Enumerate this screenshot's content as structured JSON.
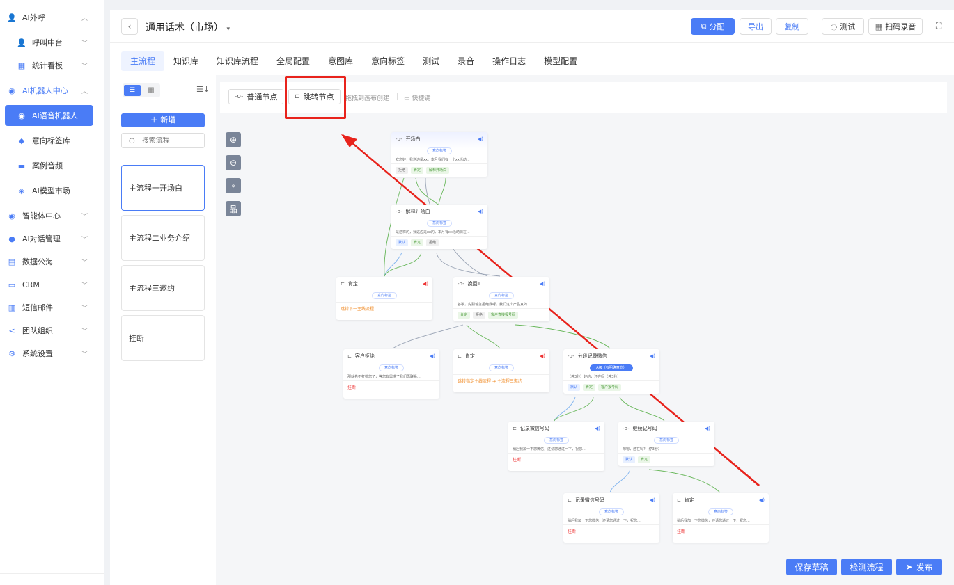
{
  "sidebar": {
    "items": [
      {
        "label": "AI外呼",
        "icon": "person-icon",
        "level": 1,
        "chev": "up"
      },
      {
        "label": "呼叫中台",
        "icon": "person-icon",
        "level": 2,
        "chev": "down"
      },
      {
        "label": "统计看板",
        "icon": "chart-icon",
        "level": 2,
        "chev": "down"
      },
      {
        "label": "AI机器人中心",
        "icon": "robot-icon",
        "level": 1,
        "chev": "up",
        "blue": true
      },
      {
        "label": "AI语音机器人",
        "icon": "robot-icon",
        "level": 2,
        "active": true
      },
      {
        "label": "意向标签库",
        "icon": "tag-icon",
        "level": 2
      },
      {
        "label": "案例音频",
        "icon": "folder-icon",
        "level": 2
      },
      {
        "label": "AI模型市场",
        "icon": "cube-icon",
        "level": 2
      },
      {
        "label": "智能体中心",
        "icon": "agent-icon",
        "level": 1,
        "chev": "down"
      },
      {
        "label": "AI对话管理",
        "icon": "chat-icon",
        "level": 1,
        "chev": "down"
      },
      {
        "label": "数据公海",
        "icon": "data-icon",
        "level": 1,
        "chev": "down"
      },
      {
        "label": "CRM",
        "icon": "crm-icon",
        "level": 1,
        "chev": "down"
      },
      {
        "label": "短信邮件",
        "icon": "mail-icon",
        "level": 1,
        "chev": "down"
      },
      {
        "label": "团队组织",
        "icon": "team-icon",
        "level": 1,
        "chev": "down"
      },
      {
        "label": "系统设置",
        "icon": "gear-icon",
        "level": 1,
        "chev": "down"
      }
    ]
  },
  "header": {
    "title": "通用话术（市场）",
    "buttons": {
      "assign": "分配",
      "export": "导出",
      "copy": "复制",
      "test": "测试",
      "scan": "扫码录音"
    }
  },
  "tabs": [
    "主流程",
    "知识库",
    "知识库流程",
    "全局配置",
    "意图库",
    "意向标签",
    "测试",
    "录音",
    "操作日志",
    "模型配置"
  ],
  "left": {
    "add": "新增",
    "search_placeholder": "搜索流程",
    "flows": [
      "主流程一开场白",
      "主流程二业务介绍",
      "主流程三邀约",
      "挂断"
    ]
  },
  "nodebar": {
    "normal": "普通节点",
    "jump": "跳转节点",
    "hint": "拖拽到画布创建",
    "shortcut": "快捷键"
  },
  "nodes": {
    "n1": {
      "title": "开场白",
      "tag": "意向标签",
      "text": "欢您好，我这边是xx。本月我们有一个xx活动...",
      "pills": [
        "拒绝",
        "肯定",
        "解释开场白"
      ]
    },
    "n2": {
      "title": "解释开场白",
      "tag": "意向标签",
      "text": "是这样的，我这边是xx的，本月有xx活动现在...",
      "pills": [
        "默认",
        "肯定",
        "拒绝"
      ]
    },
    "n3": {
      "title": "肯定",
      "tag": "意向标签",
      "action": "跳转下一主线流程"
    },
    "n4": {
      "title": "挽回1",
      "tag": "意向标签",
      "text": "谷歌，先别着急拒绝我呀，我们这个产品真的...",
      "pills": [
        "肯定",
        "拒绝",
        "客户直接报号码"
      ]
    },
    "n5": {
      "title": "客户拒绝",
      "tag": "意向标签",
      "text": "那就先不打扰您了，等您有需求了我们再联系...",
      "action": "挂断"
    },
    "n6": {
      "title": "肯定",
      "tag": "意向标签",
      "action": "跳转指定主线流程 → 主流程三邀约"
    },
    "n7": {
      "title": "分段记录微信",
      "tag": "A级（有明确意向）",
      "text": "（停3秒）好的，还在吗（停3秒）",
      "pills": [
        "默认",
        "肯定",
        "客户报号码"
      ]
    },
    "n8": {
      "title": "记录微信号码",
      "tag": "意向标签",
      "text": "稍后我加一下您微信，还请您通过一下，祝您...",
      "action": "挂断"
    },
    "n9": {
      "title": "继续记号码",
      "tag": "意向标签",
      "text": "嗯嗯，还在吗?（停3秒）",
      "pills": [
        "默认",
        "肯定"
      ]
    },
    "n10": {
      "title": "记录微信号码",
      "tag": "意向标签",
      "text": "稍后我加一下您微信，还请您通过一下，祝您...",
      "action": "挂断"
    },
    "n11": {
      "title": "肯定",
      "tag": "意向标签",
      "text": "稍后我加一下您微信，还请您通过一下，祝您...",
      "action": "挂断"
    }
  },
  "bottom": {
    "save": "保存草稿",
    "check": "检测流程",
    "publish": "发布"
  }
}
